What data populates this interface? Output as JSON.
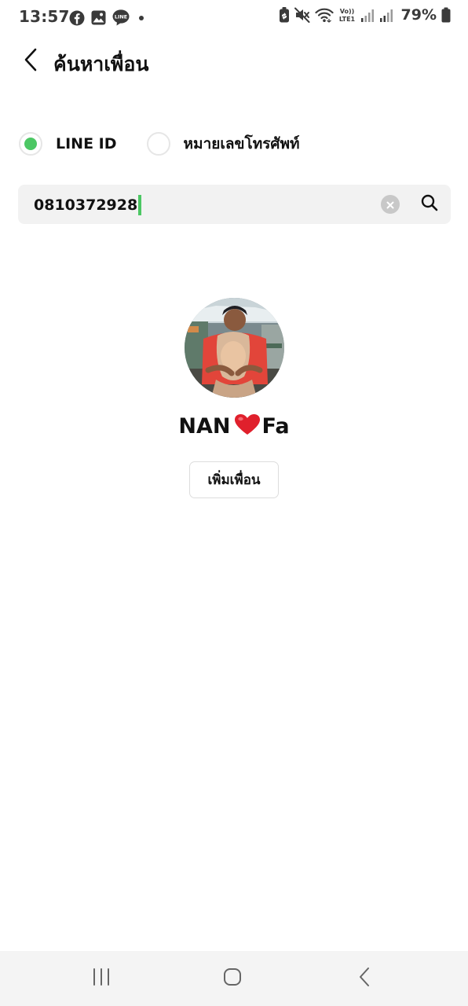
{
  "status_bar": {
    "time": "13:57",
    "left_icons": [
      "facebook-icon",
      "gallery-icon",
      "line-icon",
      "dot-icon"
    ],
    "line_icon_text": "LINE",
    "volte_label_top": "Vo))",
    "volte_label_bottom": "LTE1",
    "right_icons": [
      "battery-saver-icon",
      "mute-icon",
      "wifi-icon",
      "volte-icon",
      "signal-icon",
      "signal-icon",
      "battery-icon"
    ],
    "battery_percent": "79%"
  },
  "header": {
    "back_icon": "chevron-left-icon",
    "title": "ค้นหาเพื่อน"
  },
  "search_type": {
    "options": [
      {
        "label": "LINE ID",
        "selected": true
      },
      {
        "label": "หมายเลขโทรศัพท์",
        "selected": false
      }
    ]
  },
  "search": {
    "value": "0810372928",
    "clear_icon": "clear-icon",
    "search_icon": "search-icon"
  },
  "result": {
    "name_part1": "NAN",
    "name_emoji": "❤️",
    "name_part2": "Fa",
    "add_button_label": "เพิ่มเพื่อน"
  },
  "nav_bar": {
    "recents_icon": "recents-icon",
    "home_icon": "home-icon",
    "back_icon": "back-icon"
  },
  "colors": {
    "accent_green": "#4cc764",
    "search_background": "#f2f2f2",
    "nav_background": "#f4f4f4",
    "text": "#111111"
  }
}
